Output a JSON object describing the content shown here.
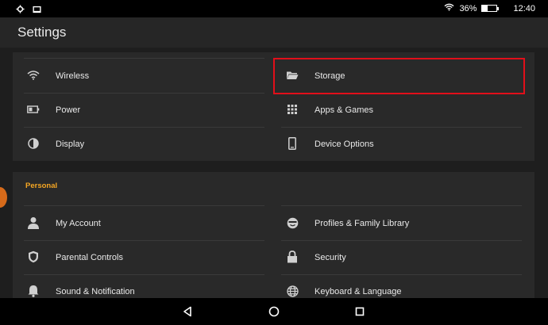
{
  "status_bar": {
    "icons": [
      "gear-icon",
      "photo-icon"
    ],
    "wifi_icon": "wifi-icon",
    "battery_text": "36%",
    "battery_level": 0.36,
    "time": "12:40"
  },
  "app_bar": {
    "title": "Settings"
  },
  "device_section": {
    "left": [
      {
        "label": "Wireless",
        "icon": "wifi-icon"
      },
      {
        "label": "Power",
        "icon": "battery-icon"
      },
      {
        "label": "Display",
        "icon": "contrast-icon"
      }
    ],
    "right": [
      {
        "label": "Storage",
        "icon": "folder-icon"
      },
      {
        "label": "Apps & Games",
        "icon": "grid-icon"
      },
      {
        "label": "Device Options",
        "icon": "phone-icon"
      }
    ]
  },
  "personal_section": {
    "title": "Personal",
    "left": [
      {
        "label": "My Account",
        "icon": "person-icon"
      },
      {
        "label": "Parental Controls",
        "icon": "shield-icon"
      },
      {
        "label": "Sound & Notification",
        "icon": "bell-icon"
      }
    ],
    "right": [
      {
        "label": "Profiles & Family Library",
        "icon": "face-icon"
      },
      {
        "label": "Security",
        "icon": "lock-icon"
      },
      {
        "label": "Keyboard & Language",
        "icon": "globe-icon"
      }
    ]
  },
  "nav_bar": {
    "icons": [
      "back-icon",
      "home-icon",
      "recents-icon"
    ]
  },
  "colors": {
    "accent": "#f5a623",
    "highlight": "#e10f1a",
    "panel": "#292929",
    "background": "#1e1e1e"
  }
}
